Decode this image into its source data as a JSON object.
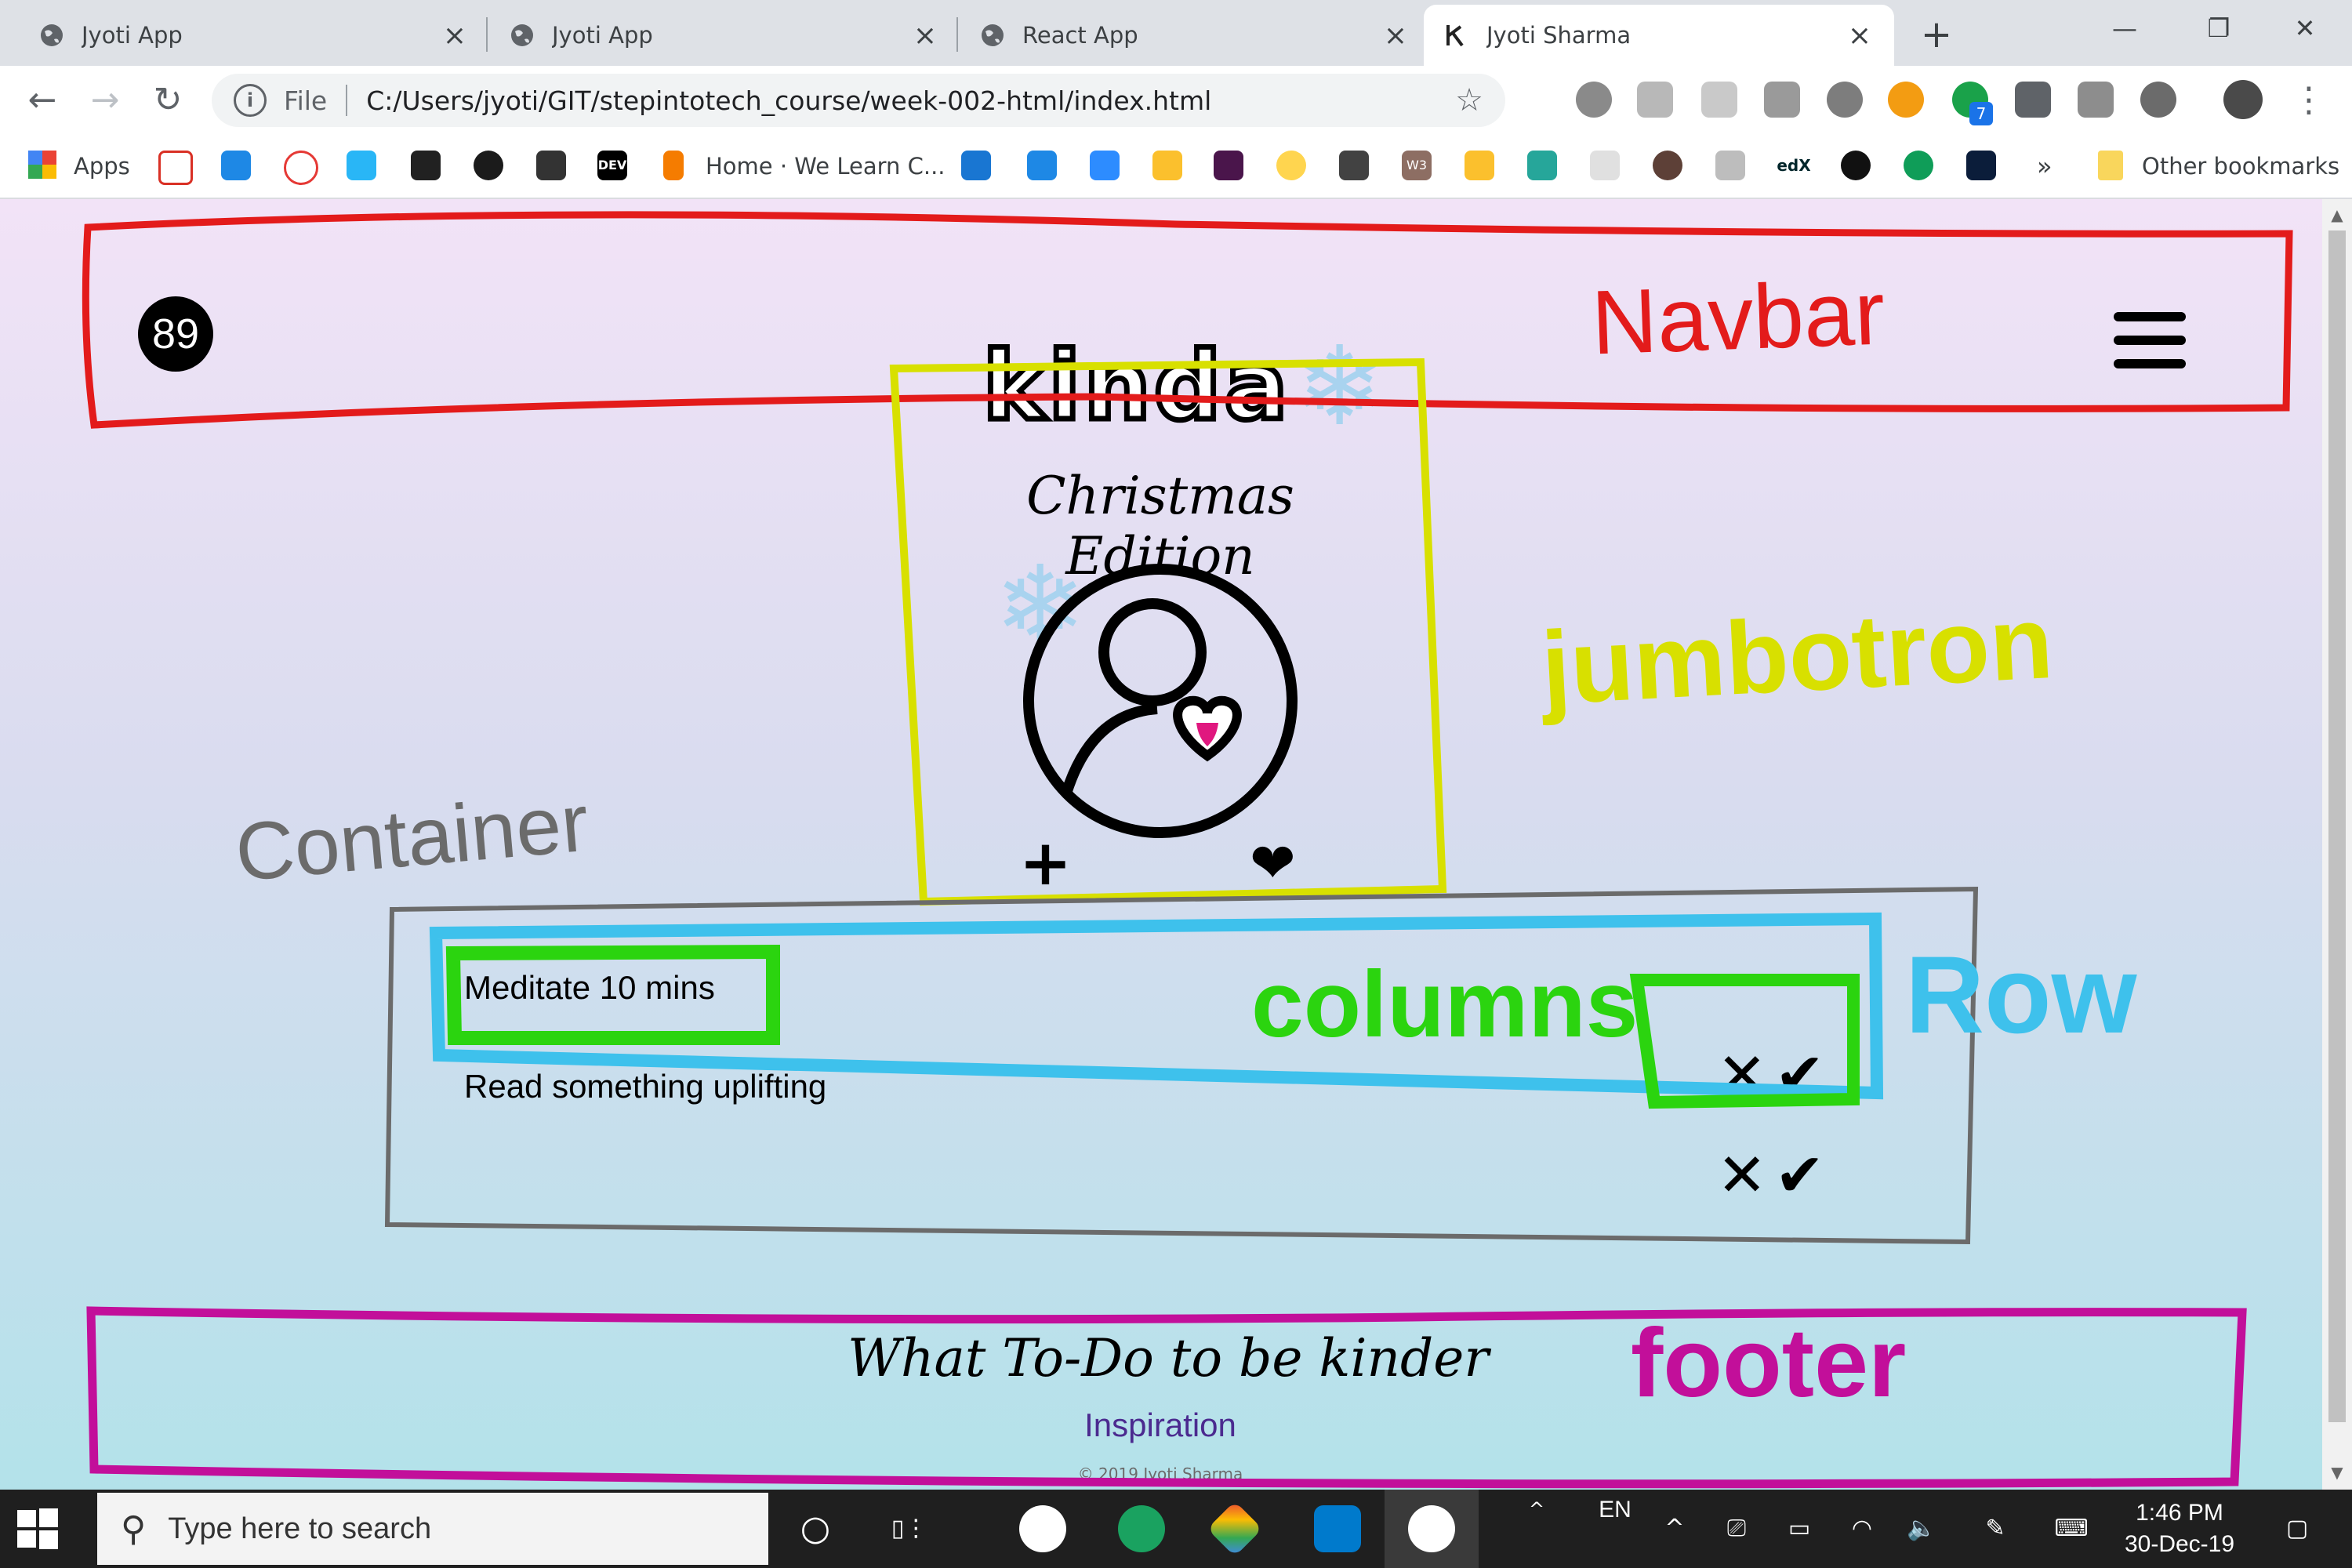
{
  "browser": {
    "tabs": [
      {
        "title": "Jyoti App",
        "icon": "globe-icon",
        "active": false
      },
      {
        "title": "Jyoti App",
        "icon": "globe-icon",
        "active": false
      },
      {
        "title": "React App",
        "icon": "globe-icon",
        "active": false
      },
      {
        "title": "Jyoti Sharma",
        "icon": "k-logo-icon",
        "active": true
      }
    ],
    "address": {
      "scheme_label": "File",
      "url": "C:/Users/jyoti/GIT/stepintotech_course/week-002-html/index.html"
    },
    "extension_badge": "7"
  },
  "bookmarks": {
    "apps_label": "Apps",
    "home_label": "Home · We Learn C...",
    "dev_label": "DEV",
    "w3_label": "W3",
    "edx_label": "edX",
    "overflow_label": "»",
    "other_label": "Other bookmarks"
  },
  "page": {
    "badge": "89",
    "brand": "kinda",
    "edition": "Christmas Edition",
    "items": [
      {
        "label": "Meditate 10 mins"
      },
      {
        "label": "Read something uplifting"
      }
    ],
    "footer_title": "What To-Do to be kinder",
    "footer_link": "Inspiration",
    "copyright": "© 2019 Jyoti Sharma",
    "colors": {
      "heart": "#e0187f",
      "snowflake": "#a9d3ef",
      "link": "#4b2a8f"
    }
  },
  "annotations": {
    "navbar": "Navbar",
    "jumbotron": "jumbotron",
    "container": "Container",
    "columns": "columns",
    "row": "Row",
    "footer": "footer",
    "colors": {
      "navbar": "#e31b1b",
      "jumbotron": "#d8e000",
      "container": "#6b6b6b",
      "row": "#3ec1ec",
      "columns": "#2bd40f",
      "footer": "#c20f9a"
    }
  },
  "taskbar": {
    "search_placeholder": "Type here to search",
    "language": "EN",
    "time": "1:46 PM",
    "date": "30-Dec-19"
  }
}
